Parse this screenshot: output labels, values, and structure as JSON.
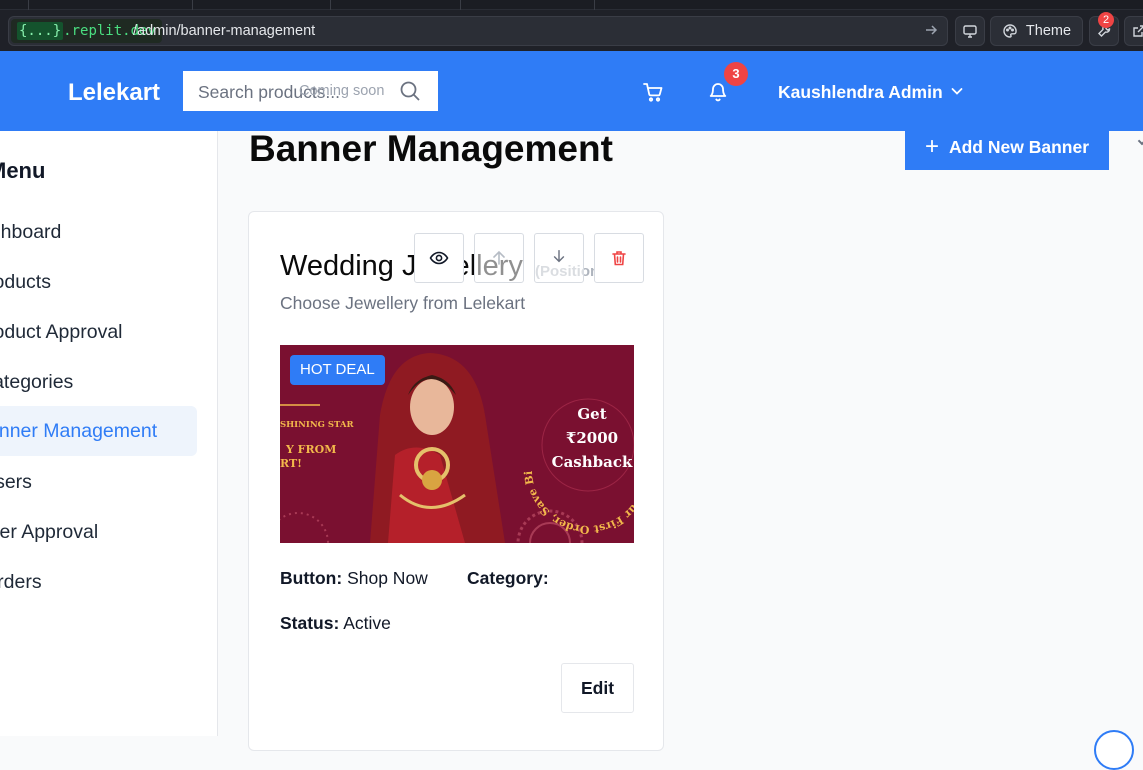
{
  "browser": {
    "domain": "{...}.replit.dev",
    "domain_brace": "{...}",
    "domain_rest": ".replit.dev",
    "path": "/admin/banner-management",
    "theme_label": "Theme",
    "devtools_badge": "2"
  },
  "header": {
    "logo": "Lelekart",
    "search_placeholder": "Search products...",
    "search_note": "Coming soon",
    "notification_count": "3",
    "user_name": "Kaushlendra Admin"
  },
  "sidebar": {
    "title": "Menu",
    "items": [
      {
        "label": "Dashboard",
        "active": false
      },
      {
        "label": "Products",
        "active": false
      },
      {
        "label": "Product Approval",
        "active": false
      },
      {
        "label": "Categories",
        "active": false
      },
      {
        "label": "Banner Management",
        "active": true
      },
      {
        "label": "Users",
        "active": false
      },
      {
        "label": "Seller Approval",
        "active": false
      },
      {
        "label": "Orders",
        "active": false
      }
    ]
  },
  "main": {
    "page_title": "Banner Management",
    "add_button": "Add New Banner"
  },
  "banner_card": {
    "title": "Wedding Jewellery",
    "subtitle": "Choose Jewellery from Lelekart",
    "position_label": "(Position",
    "badge": "HOT DEAL",
    "image": {
      "left_text_1": "SHINING STAR",
      "left_text_2": "Y FROM",
      "left_text_3": "RT!",
      "ring_text": "On Your First Order, Save Big With Lelekart",
      "offer_1": "Get",
      "offer_2": "₹2000",
      "offer_3": "Cashback"
    },
    "button_label": "Button:",
    "button_value": "Shop Now",
    "category_label": "Category:",
    "category_value": "",
    "status_label": "Status:",
    "status_value": "Active",
    "edit_label": "Edit"
  },
  "colors": {
    "primary": "#2f7cf6",
    "danger": "#ef4444",
    "banner_bg": "#7a1030",
    "banner_gold": "#f2b84b"
  }
}
